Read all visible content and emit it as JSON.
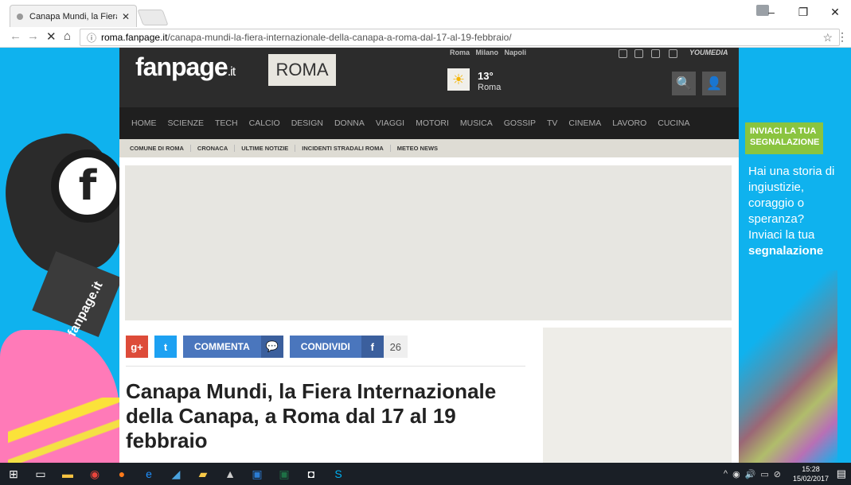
{
  "browser": {
    "tab_title": "Canapa Mundi, la Fiera I",
    "tab_close": "✕",
    "url_host": "roma.fanpage.it",
    "url_path": "/canapa-mundi-la-fiera-internazionale-della-canapa-a-roma-dal-17-al-19-febbraio/",
    "info_icon": "ⓘ",
    "star_icon": "☆",
    "back_icon": "←",
    "forward_icon": "→",
    "stop_icon": "✕",
    "home_icon": "⌂",
    "menu_icon": "⋮",
    "min_icon": "–",
    "max_icon": "❐",
    "close_icon": "✕"
  },
  "site": {
    "logo": "fanpage",
    "logo_tld": ".it",
    "city": "ROMA",
    "cities": [
      "Roma",
      "Milano",
      "Napoli"
    ],
    "weather_temp": "13°",
    "weather_city": "Roma",
    "weather_icon": "☀",
    "youmedia": "YOUMEDIA",
    "search_icon": "🔍",
    "user_icon": "👤",
    "nav": [
      "HOME",
      "SCIENZE",
      "TECH",
      "CALCIO",
      "DESIGN",
      "DONNA",
      "VIAGGI",
      "MOTORI",
      "MUSICA",
      "GOSSIP",
      "TV",
      "CINEMA",
      "LAVORO",
      "CUCINA"
    ],
    "subnav": [
      "COMUNE DI ROMA",
      "CRONACA",
      "ULTIME NOTIZIE",
      "INCIDENTI STRADALI ROMA",
      "METEO NEWS"
    ]
  },
  "article": {
    "gplus": "g+",
    "twitter": "t",
    "commenta": "COMMENTA",
    "condividi": "CONDIVIDI",
    "facebook": "f",
    "share_count": "26",
    "headline": "Canapa Mundi, la Fiera Internazionale della Canapa, a Roma dal 17 al 19 febbraio"
  },
  "banner": {
    "cta": "INVIACI LA TUA SEGNALAZIONE",
    "text": "Hai una storia di ingiustizie, coraggio o speranza? Inviaci la tua",
    "text_bold": "segnalazione",
    "mic_brand": "fanpage.it"
  },
  "taskbar": {
    "start_icon": "⊞",
    "time": "15:28",
    "date": "15/02/2017",
    "tray": [
      "^",
      "◉",
      "🔊",
      "▭",
      "⊘"
    ]
  },
  "colors": {
    "page_bg": "#0fb2ee",
    "header_bg": "#2c2c2c",
    "cta_green": "#8ac43f",
    "share_blue": "#4a76bd",
    "gplus_red": "#dd4b39",
    "twitter_blue": "#1da1f2"
  }
}
